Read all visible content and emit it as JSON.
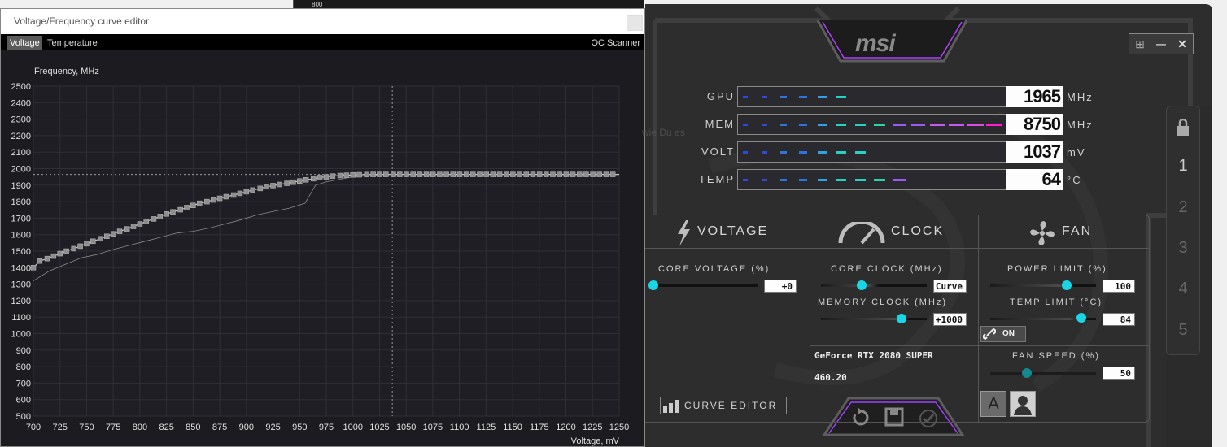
{
  "background": {
    "top_label": "800"
  },
  "curve_editor": {
    "title": "Voltage/Frequency curve editor",
    "tabs": [
      "Voltage",
      "Temperature"
    ],
    "oc_scanner": "OC Scanner",
    "ylabel": "Frequency, MHz",
    "xlabel": "Voltage, mV"
  },
  "chart_data": {
    "type": "line",
    "title": "",
    "xlabel": "Voltage, mV",
    "ylabel": "Frequency, MHz",
    "xlim": [
      700,
      1250
    ],
    "ylim": [
      500,
      2500
    ],
    "xticks": [
      700,
      725,
      750,
      775,
      800,
      825,
      850,
      875,
      900,
      925,
      950,
      975,
      1000,
      1025,
      1050,
      1075,
      1100,
      1125,
      1150,
      1175,
      1200,
      1225,
      1250
    ],
    "yticks": [
      500,
      600,
      700,
      800,
      900,
      1000,
      1100,
      1200,
      1300,
      1400,
      1500,
      1600,
      1700,
      1800,
      1900,
      2000,
      2100,
      2200,
      2300,
      2400,
      2500
    ],
    "grid": true,
    "crosshair": {
      "x": 1037,
      "y": 1965
    },
    "series": [
      {
        "x": [
          700,
          706,
          713,
          719,
          725,
          731,
          738,
          744,
          750,
          756,
          763,
          769,
          775,
          781,
          788,
          794,
          800,
          806,
          813,
          819,
          825,
          831,
          838,
          844,
          850,
          856,
          863,
          869,
          875,
          881,
          888,
          894,
          900,
          906,
          913,
          919,
          925,
          931,
          938,
          944,
          950,
          956,
          963,
          969,
          975,
          981,
          988,
          994,
          1000,
          1006,
          1013,
          1019,
          1025,
          1031,
          1038,
          1250
        ],
        "y": [
          1400,
          1440,
          1455,
          1470,
          1485,
          1500,
          1515,
          1530,
          1545,
          1560,
          1575,
          1590,
          1605,
          1620,
          1635,
          1650,
          1665,
          1680,
          1695,
          1710,
          1725,
          1738,
          1751,
          1764,
          1777,
          1790,
          1800,
          1810,
          1820,
          1830,
          1840,
          1850,
          1860,
          1870,
          1880,
          1890,
          1897,
          1904,
          1911,
          1918,
          1925,
          1932,
          1939,
          1946,
          1950,
          1955,
          1958,
          1960,
          1962,
          1963,
          1964,
          1965,
          1965,
          1965,
          1965,
          1965
        ]
      },
      {
        "x": [
          700,
          715,
          730,
          745,
          760,
          775,
          790,
          805,
          820,
          835,
          850,
          865,
          880,
          895,
          910,
          925,
          940,
          955,
          965,
          975,
          1000,
          1025,
          1038
        ],
        "y": [
          1320,
          1380,
          1420,
          1460,
          1480,
          1510,
          1535,
          1560,
          1585,
          1610,
          1620,
          1640,
          1665,
          1690,
          1720,
          1740,
          1760,
          1790,
          1900,
          1920,
          1950,
          1962,
          1965
        ]
      }
    ]
  },
  "afterburner": {
    "brand": "msi",
    "readouts": [
      {
        "label": "GPU",
        "value": "1965",
        "unit": "MHz",
        "fill": 0.45
      },
      {
        "label": "MEM",
        "value": "8750",
        "unit": "MHz",
        "fill": 1.0
      },
      {
        "label": "VOLT",
        "value": "1037",
        "unit": "mV",
        "fill": 0.5
      },
      {
        "label": "TEMP",
        "value": "64",
        "unit": "°C",
        "fill": 0.64
      }
    ],
    "sections": {
      "voltage": "VOLTAGE",
      "clock": "CLOCK",
      "fan": "FAN"
    },
    "core_voltage": {
      "label": "CORE VOLTAGE  (%)",
      "value": "+0",
      "level": 0.0
    },
    "core_clock": {
      "label": "CORE CLOCK (MHz)",
      "value": "Curve",
      "level": 0.5
    },
    "memory_clock": {
      "label": "MEMORY CLOCK (MHz)",
      "value": "+1000",
      "level": 0.75
    },
    "power_limit": {
      "label": "POWER LIMIT  (%)",
      "value": "100",
      "level": 0.7
    },
    "temp_limit": {
      "label": "TEMP LIMIT (°C)",
      "value": "84",
      "level": 0.8
    },
    "link_toggle": "ON",
    "gpu_name": "GeForce RTX 2080 SUPER",
    "driver": "460.20",
    "fan_speed": {
      "label": "FAN SPEED (%)",
      "value": "50",
      "level": 0.3
    },
    "curve_editor_button": "CURVE EDITOR",
    "auto_button": "A",
    "profiles": [
      "1",
      "2",
      "3",
      "4",
      "5"
    ],
    "window_buttons": [
      "⊞",
      "—",
      "✕"
    ],
    "ghost_text": "wie Du es"
  }
}
